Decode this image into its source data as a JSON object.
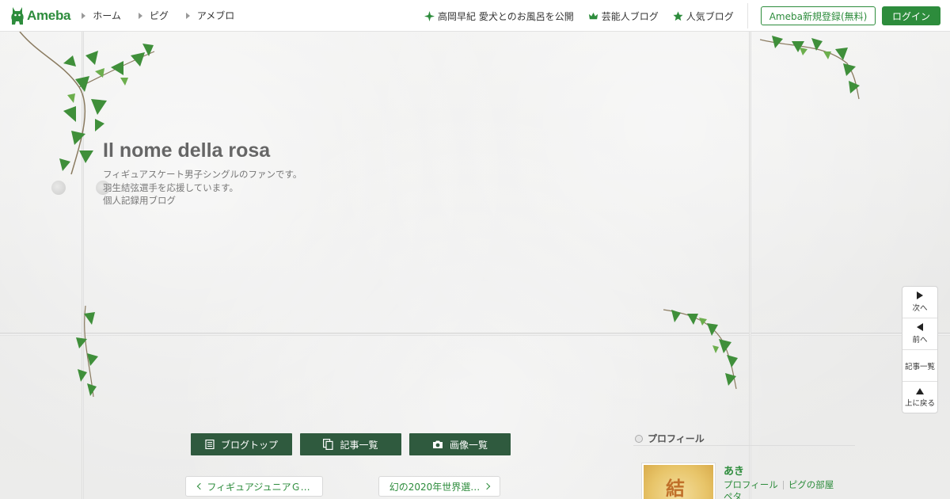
{
  "header": {
    "logo_text": "Ameba",
    "nav": [
      {
        "label": "ホーム"
      },
      {
        "label": "ピグ"
      },
      {
        "label": "アメブロ"
      }
    ],
    "right_nav": [
      {
        "label": "高岡早紀 愛犬とのお風呂を公開",
        "icon": "sparkle-icon"
      },
      {
        "label": "芸能人ブログ",
        "icon": "crown-icon"
      },
      {
        "label": "人気ブログ",
        "icon": "star-icon"
      }
    ],
    "register_label": "Ameba新規登録(無料)",
    "login_label": "ログイン"
  },
  "blog": {
    "title": "Il nome della rosa",
    "description": [
      "フィギュアスケート男子シングルのファンです。",
      "羽生結弦選手を応援しています。",
      "個人記録用ブログ"
    ]
  },
  "pager": {
    "next": "次へ",
    "prev": "前へ",
    "list": "記事一覧",
    "top": "上に戻る"
  },
  "blog_nav": {
    "top": "ブログトップ",
    "articles": "記事一覧",
    "images": "画像一覧"
  },
  "article_nav": {
    "prev": "フィギュアジュニアＧ…",
    "next": "幻の2020年世界選…"
  },
  "profile": {
    "heading": "プロフィール",
    "name": "あき",
    "links": [
      "プロフィール",
      "ピグの部屋"
    ],
    "peta": "ペタ",
    "avatar_char": "結"
  },
  "colors": {
    "brand": "#2d8c3c",
    "button_dark": "#2f5a3e"
  }
}
